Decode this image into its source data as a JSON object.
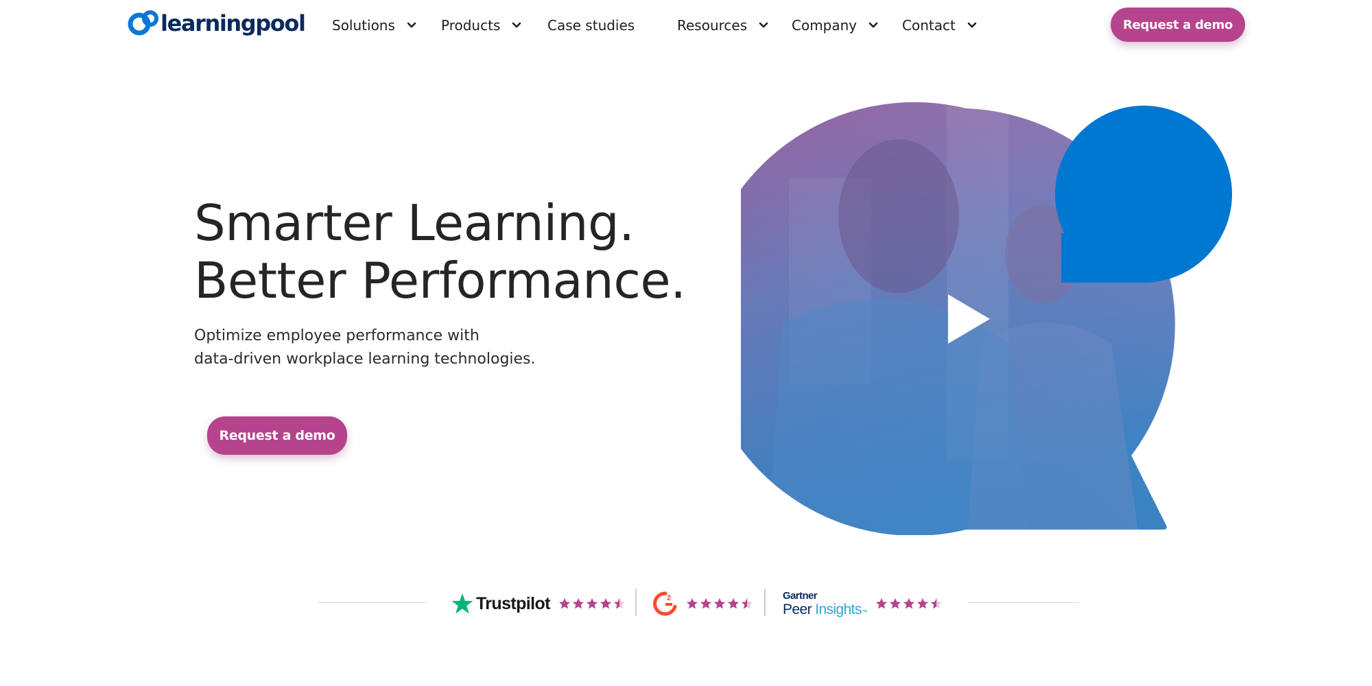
{
  "brand": {
    "name": "learningpool",
    "accent": "#b5448c",
    "logo_color": "#0b2a5c",
    "logo_mark_color": "#0b77d8"
  },
  "nav": {
    "items": [
      {
        "label": "Solutions",
        "has_dropdown": true
      },
      {
        "label": "Products",
        "has_dropdown": true
      },
      {
        "label": "Case studies",
        "has_dropdown": false
      },
      {
        "label": "Resources",
        "has_dropdown": true
      },
      {
        "label": "Company",
        "has_dropdown": true
      },
      {
        "label": "Contact",
        "has_dropdown": true
      }
    ],
    "cta_label": "Request a demo"
  },
  "hero": {
    "title_line1": "Smarter Learning.",
    "title_line2": "Better Performance.",
    "subtitle_line1": "Optimize employee performance with",
    "subtitle_line2": "data-driven workplace learning technologies.",
    "cta_label": "Request a demo"
  },
  "video": {
    "play_icon": "play-icon",
    "bubble_color": "#0077d0",
    "gradient_top": "#a35a97",
    "gradient_bottom": "#2f7fc0"
  },
  "ratings": [
    {
      "provider": "Trustpilot",
      "rating": 4.5,
      "max": 5
    },
    {
      "provider": "G2",
      "rating": 4.5,
      "max": 5
    },
    {
      "provider_top": "Gartner",
      "provider_bottom_a": "Peer",
      "provider_bottom_b": "Insights",
      "provider_bottom_tm": "™",
      "rating": 4.5,
      "max": 5
    }
  ],
  "ratings_star_color": "#b5448c"
}
